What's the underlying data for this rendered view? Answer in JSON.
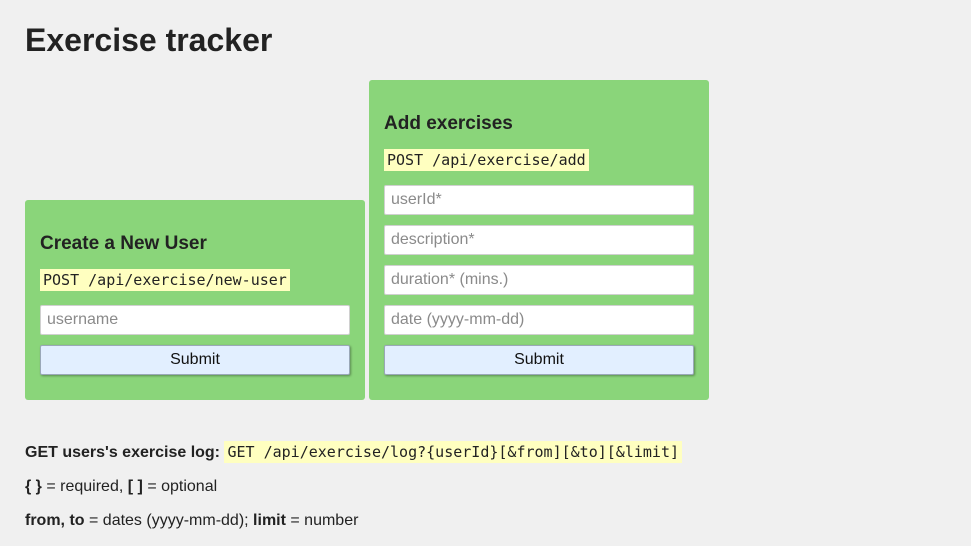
{
  "page": {
    "title": "Exercise tracker"
  },
  "new_user": {
    "heading": "Create a New User",
    "endpoint": "POST /api/exercise/new-user",
    "username_placeholder": "username",
    "submit_label": "Submit"
  },
  "add_exercise": {
    "heading": "Add exercises",
    "endpoint": "POST /api/exercise/add",
    "userid_placeholder": "userId*",
    "description_placeholder": "description*",
    "duration_placeholder": "duration* (mins.)",
    "date_placeholder": "date (yyyy-mm-dd)",
    "submit_label": "Submit"
  },
  "notes": {
    "log_label": "GET users's exercise log:",
    "log_endpoint": "GET /api/exercise/log?{userId}[&from][&to][&limit]",
    "required_symbol": "{ }",
    "required_text": "= required,",
    "optional_symbol": "[ ]",
    "optional_text": "= optional",
    "from_to_label": "from, to",
    "from_to_text": "= dates (yyyy-mm-dd);",
    "limit_label": "limit",
    "limit_text": "= number"
  },
  "colors": {
    "panel_background": "#8ad57a",
    "code_highlight": "#ffffc0",
    "button_background": "#e2efff",
    "page_background": "#f0f0f0"
  }
}
